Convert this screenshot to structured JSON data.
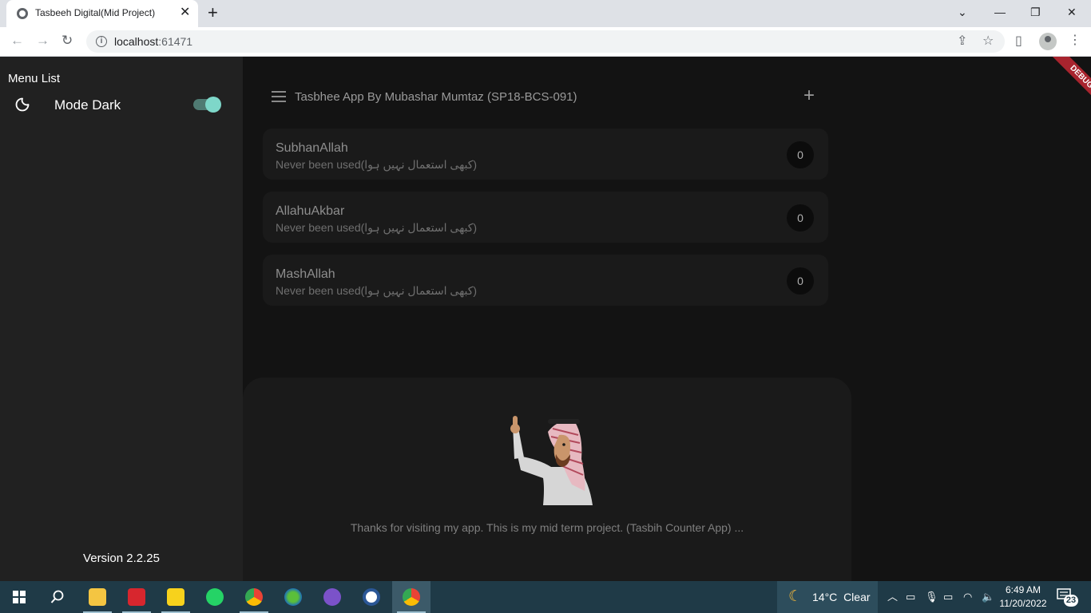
{
  "browser": {
    "tab_title": "Tasbeeh Digital(Mid Project)",
    "tab_close": "✕",
    "new_tab": "+",
    "url_host": "localhost",
    "url_port": ":61471",
    "window_controls": {
      "minimize": "—",
      "restore": "❐",
      "close": "✕",
      "tab_search": "⌄"
    }
  },
  "drawer": {
    "title": "Menu List",
    "mode_label": "Mode Dark",
    "dark_mode_on": true,
    "version": "Version 2.2.25"
  },
  "appbar": {
    "title": "Tasbhee App By Mubashar Mumtaz (SP18-BCS-091)",
    "add_label": "+"
  },
  "tasbeeh_list": [
    {
      "name": "SubhanAllah",
      "status": "Never been used(کبھی استعمال نہیں ہوا)",
      "count": "0"
    },
    {
      "name": "AllahuAkbar",
      "status": "Never been used(کبھی استعمال نہیں ہوا)",
      "count": "0"
    },
    {
      "name": "MashAllah",
      "status": "Never been used(کبھی استعمال نہیں ہوا)",
      "count": "0"
    }
  ],
  "about": {
    "text": "Thanks for visiting my app. This is my mid term project. (Tasbih Counter App) ..."
  },
  "debug_banner": "DEBUG",
  "taskbar": {
    "apps": [
      "windows-start",
      "search",
      "file-explorer",
      "media-app",
      "sticky-notes",
      "whatsapp",
      "chrome-profile",
      "internet-download",
      "github-desktop",
      "word-app",
      "chrome"
    ],
    "weather_temp": "14°C",
    "weather_desc": "Clear",
    "time": "6:49 AM",
    "date": "11/20/2022",
    "notification_count": "23"
  },
  "colors": {
    "accent": "#7ed7c9",
    "drawer_bg": "#212121",
    "main_bg": "#131313",
    "card_bg": "#1a1a1a",
    "taskbar_bg": "#1f3a47"
  }
}
